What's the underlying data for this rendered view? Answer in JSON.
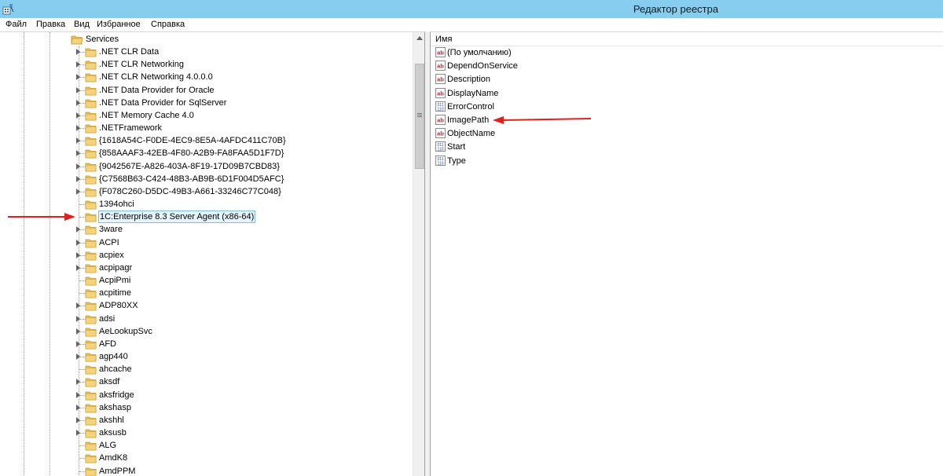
{
  "window": {
    "title": "Редактор реестра",
    "icon": "regedit-icon"
  },
  "menu": [
    "Файл",
    "Правка",
    "Вид",
    "Избранное",
    "Справка"
  ],
  "tree": {
    "parent": {
      "label": "Services",
      "expanded": true
    },
    "items": [
      {
        "label": ".NET CLR Data",
        "has_children": true
      },
      {
        "label": ".NET CLR Networking",
        "has_children": true
      },
      {
        "label": ".NET CLR Networking 4.0.0.0",
        "has_children": true
      },
      {
        "label": ".NET Data Provider for Oracle",
        "has_children": true
      },
      {
        "label": ".NET Data Provider for SqlServer",
        "has_children": true
      },
      {
        "label": ".NET Memory Cache 4.0",
        "has_children": true
      },
      {
        "label": ".NETFramework",
        "has_children": true
      },
      {
        "label": "{1618A54C-F0DE-4EC9-8E5A-4AFDC411C70B}",
        "has_children": true
      },
      {
        "label": "{858AAAF3-42EB-4F80-A2B9-FA8FAA5D1F7D}",
        "has_children": true
      },
      {
        "label": "{9042567E-A826-403A-8F19-17D09B7CBD83}",
        "has_children": true
      },
      {
        "label": "{C7568B63-C424-48B3-AB9B-6D1F004D5AFC}",
        "has_children": true
      },
      {
        "label": "{F078C260-D5DC-49B3-A661-33246C77C048}",
        "has_children": true
      },
      {
        "label": "1394ohci",
        "has_children": false
      },
      {
        "label": "1C:Enterprise 8.3 Server Agent (x86-64)",
        "has_children": false,
        "selected": true
      },
      {
        "label": "3ware",
        "has_children": true
      },
      {
        "label": "ACPI",
        "has_children": true
      },
      {
        "label": "acpiex",
        "has_children": true
      },
      {
        "label": "acpipagr",
        "has_children": true
      },
      {
        "label": "AcpiPmi",
        "has_children": false
      },
      {
        "label": "acpitime",
        "has_children": false
      },
      {
        "label": "ADP80XX",
        "has_children": true
      },
      {
        "label": "adsi",
        "has_children": true
      },
      {
        "label": "AeLookupSvc",
        "has_children": true
      },
      {
        "label": "AFD",
        "has_children": true
      },
      {
        "label": "agp440",
        "has_children": true
      },
      {
        "label": "ahcache",
        "has_children": false
      },
      {
        "label": "aksdf",
        "has_children": true
      },
      {
        "label": "aksfridge",
        "has_children": true
      },
      {
        "label": "akshasp",
        "has_children": true
      },
      {
        "label": "akshhl",
        "has_children": true
      },
      {
        "label": "aksusb",
        "has_children": true
      },
      {
        "label": "ALG",
        "has_children": false
      },
      {
        "label": "AmdK8",
        "has_children": false
      },
      {
        "label": "AmdPPM",
        "has_children": false
      }
    ]
  },
  "values_pane": {
    "column_header": "Имя",
    "values": [
      {
        "name": "(По умолчанию)",
        "type": "string-value-icon"
      },
      {
        "name": "DependOnService",
        "type": "string-value-icon"
      },
      {
        "name": "Description",
        "type": "string-value-icon"
      },
      {
        "name": "DisplayName",
        "type": "string-value-icon"
      },
      {
        "name": "ErrorControl",
        "type": "binary-value-icon"
      },
      {
        "name": "ImagePath",
        "type": "string-value-icon"
      },
      {
        "name": "ObjectName",
        "type": "string-value-icon"
      },
      {
        "name": "Start",
        "type": "binary-value-icon"
      },
      {
        "name": "Type",
        "type": "binary-value-icon"
      }
    ]
  },
  "colors": {
    "titlebar": "#87cdf0",
    "annotation_arrow": "#e0201e",
    "folder": "#e8c15a",
    "selection": "#e5f3fb"
  }
}
